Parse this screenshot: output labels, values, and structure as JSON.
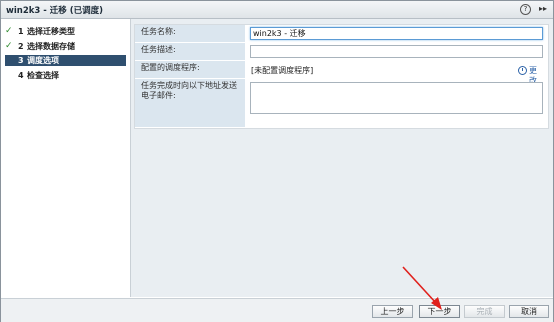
{
  "window": {
    "title": "win2k3 - 迁移 (已调度)",
    "help_icon": "?",
    "expand_icon": "▸▸"
  },
  "sidebar": {
    "steps": [
      {
        "num": "1",
        "label": "选择迁移类型",
        "status": "done",
        "mark": "✓"
      },
      {
        "num": "2",
        "label": "选择数据存储",
        "status": "done",
        "mark": "✓"
      },
      {
        "num": "3",
        "label": "调度选项",
        "status": "active",
        "mark": ""
      },
      {
        "num": "4",
        "label": "检查选择",
        "status": "pending",
        "mark": ""
      }
    ]
  },
  "form": {
    "task_name_label": "任务名称:",
    "task_name_value": "win2k3 - 迁移",
    "task_desc_label": "任务描述:",
    "task_desc_value": "",
    "scheduler_label": "配置的调度程序:",
    "scheduler_value": "[未配置调度程序]",
    "change_link": "更改",
    "email_label": "任务完成时向以下地址发送电子邮件:",
    "email_value": ""
  },
  "footer": {
    "back": "上一步",
    "next": "下一步",
    "finish": "完成",
    "cancel": "取消"
  },
  "colors": {
    "active_step_bg": "#2f4f6f",
    "label_cell_bg": "#dbe6ef",
    "link": "#2d63a8",
    "arrow": "#e0201c"
  }
}
